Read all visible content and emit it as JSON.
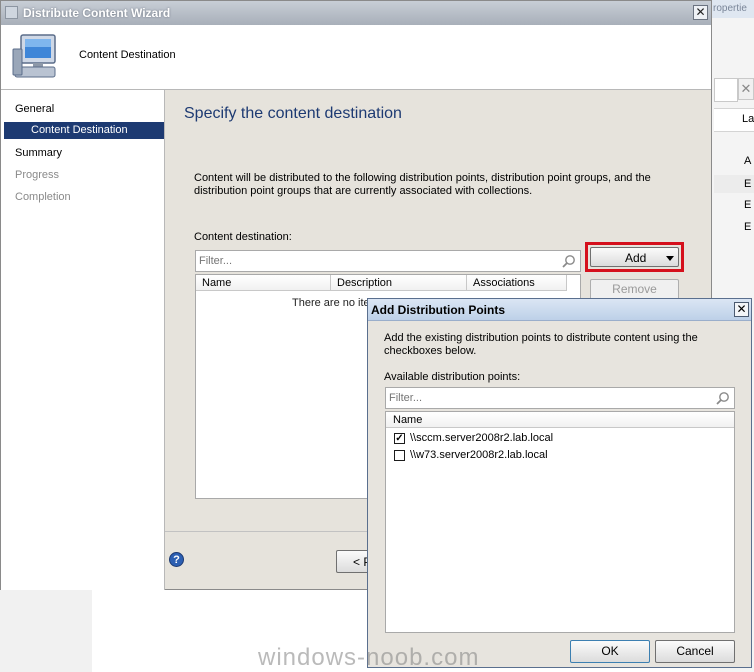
{
  "background_app": {
    "tab_fragment": "ropertie",
    "column_fragment": "La",
    "row_fragments": [
      "A",
      "E",
      "E",
      "E"
    ]
  },
  "wizard": {
    "title": "Distribute Content Wizard",
    "header_title": "Content Destination",
    "nav": [
      {
        "label": "General",
        "state": "normal"
      },
      {
        "label": "Content Destination",
        "state": "active"
      },
      {
        "label": "Summary",
        "state": "normal"
      },
      {
        "label": "Progress",
        "state": "disabled"
      },
      {
        "label": "Completion",
        "state": "disabled"
      }
    ],
    "page_heading": "Specify the content destination",
    "description": "Content will be distributed to the following distribution points, distribution point groups, and the distribution point groups that are currently associated with collections.",
    "destination_label": "Content destination:",
    "filter_placeholder": "Filter...",
    "columns": [
      "Name",
      "Description",
      "Associations"
    ],
    "empty_message": "There are no ite",
    "add_button": "Add",
    "remove_button": "Remove",
    "previous_button_fragment": "< P"
  },
  "dialog": {
    "title": "Add Distribution Points",
    "description": "Add the existing distribution points to distribute content using the checkboxes below.",
    "available_label": "Available distribution points:",
    "filter_placeholder": "Filter...",
    "column_name": "Name",
    "items": [
      {
        "label": "\\\\sccm.server2008r2.lab.local",
        "checked": true
      },
      {
        "label": "\\\\w73.server2008r2.lab.local",
        "checked": false
      }
    ],
    "ok_button": "OK",
    "cancel_button": "Cancel"
  },
  "watermark": "windows-noob.com",
  "colors": {
    "accent": "#1d3a72",
    "highlight_border": "#d5101c"
  }
}
